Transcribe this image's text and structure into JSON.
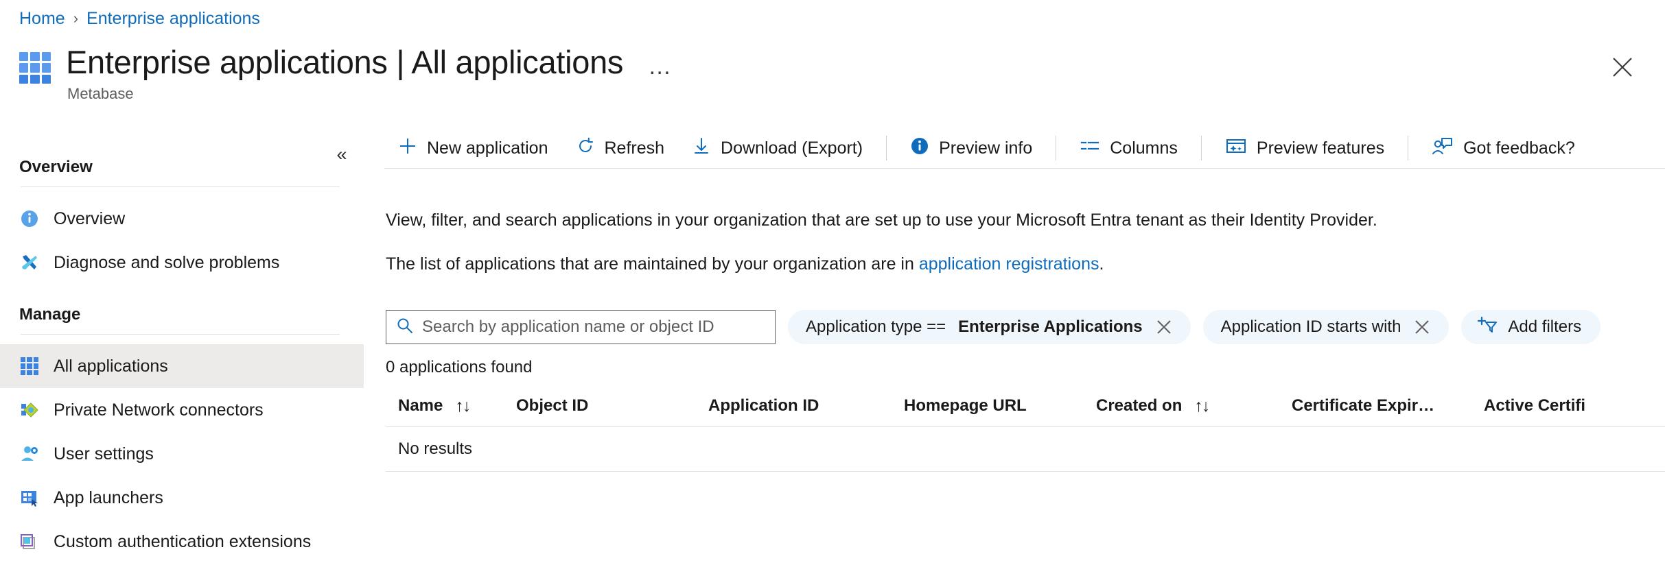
{
  "breadcrumb": {
    "home": "Home",
    "separator": "›",
    "current": "Enterprise applications"
  },
  "header": {
    "title": "Enterprise applications | All applications",
    "ellipsis": "…",
    "subtitle": "Metabase",
    "close_label": "Close"
  },
  "sidebar": {
    "collapse_glyph": "«",
    "groups": [
      {
        "title": "Overview",
        "items": [
          {
            "label": "Overview",
            "icon": "info-circle-icon"
          },
          {
            "label": "Diagnose and solve problems",
            "icon": "wrench-screwdriver-icon"
          }
        ]
      },
      {
        "title": "Manage",
        "items": [
          {
            "label": "All applications",
            "icon": "grid-apps-icon",
            "selected": true
          },
          {
            "label": "Private Network connectors",
            "icon": "network-diamond-icon"
          },
          {
            "label": "User settings",
            "icon": "user-gear-icon"
          },
          {
            "label": "App launchers",
            "icon": "app-launcher-icon"
          },
          {
            "label": "Custom authentication extensions",
            "icon": "extension-square-icon"
          }
        ]
      }
    ]
  },
  "toolbar": {
    "new_application": "New application",
    "refresh": "Refresh",
    "download_export": "Download (Export)",
    "preview_info": "Preview info",
    "columns": "Columns",
    "preview_features": "Preview features",
    "got_feedback": "Got feedback?"
  },
  "description": {
    "line1": "View, filter, and search applications in your organization that are set up to use your Microsoft Entra tenant as their Identity Provider.",
    "line2_prefix": "The list of applications that are maintained by your organization are in ",
    "line2_link": "application registrations",
    "line2_suffix": "."
  },
  "filters": {
    "search_placeholder": "Search by application name or object ID",
    "pills": [
      {
        "prefix": "Application type ==",
        "value": "Enterprise Applications",
        "removable": true
      },
      {
        "prefix": "Application ID starts with",
        "value": "",
        "removable": true
      }
    ],
    "add_filters_label": "Add filters"
  },
  "results": {
    "count_text": "0 applications found",
    "columns": [
      {
        "label": "Name",
        "sortable": true
      },
      {
        "label": "Object ID",
        "sortable": false
      },
      {
        "label": "Application ID",
        "sortable": false
      },
      {
        "label": "Homepage URL",
        "sortable": false
      },
      {
        "label": "Created on",
        "sortable": true
      },
      {
        "label": "Certificate Expir…",
        "sortable": false
      },
      {
        "label": "Active Certifi",
        "sortable": false
      }
    ],
    "sort_glyph": "↑↓",
    "empty_text": "No results"
  },
  "colors": {
    "link": "#0f6cbd",
    "accent": "#3c82e0",
    "pill_bg": "#eff6fc",
    "selected_row": "#edebe9",
    "rule": "#e1dfdd"
  }
}
